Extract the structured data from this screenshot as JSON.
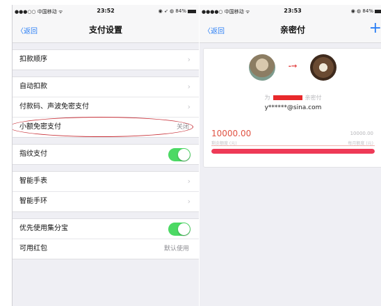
{
  "left_screen": {
    "status_bar": {
      "carrier": "●●●○○ 中国移动 ᯤ",
      "time": "23:52",
      "right": "◉ ➶ ◍ 84%"
    },
    "nav": {
      "back": "〈返回",
      "title": "支付设置"
    },
    "rows": {
      "deduct_order": "扣款顺序",
      "auto_deduct": "自动扣款",
      "pay_code": "付款码、声波免密支付",
      "small_pwd_free": "小额免密支付",
      "small_pwd_free_value": "关闭",
      "fingerprint": "指纹支付",
      "smart_watch": "智能手表",
      "smart_band": "智能手环",
      "jifenbao": "优先使用集分宝",
      "red_packet": "可用红包",
      "red_packet_value": "默认使用"
    },
    "toggles": {
      "fingerprint": true,
      "jifenbao": true
    },
    "chevron": "›"
  },
  "right_screen": {
    "status_bar": {
      "carrier": "●●●●○ 中国移动 ᯤ",
      "time": "23:53",
      "right": "◉ ◍ 84%"
    },
    "nav": {
      "back": "〈返回",
      "title": "亲密付",
      "add": "+"
    },
    "card": {
      "link_arrow": "-→",
      "label_prefix": "为",
      "label_suffix": "亲密付",
      "account": "y******@sina.com",
      "amount": "10000.00",
      "limit_amount": "10000.00",
      "remaining_label": "剩余额度 (元)",
      "monthly_label": "每月额度 (元)",
      "remaining_fraction": 1.0
    }
  },
  "colors": {
    "accent": "#2b7ff5",
    "toggle_on": "#4cd964",
    "amount": "#e05242",
    "progress": "#ee3a57",
    "annotation": "#c8323a"
  }
}
